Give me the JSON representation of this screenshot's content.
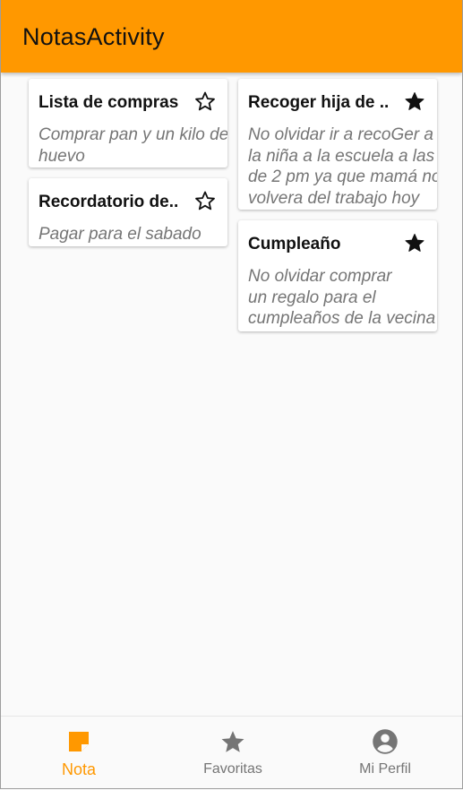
{
  "appbar": {
    "title": "NotasActivity"
  },
  "notes": [
    {
      "title": "Lista de compras",
      "body": "Comprar pan y un kilo de\nhuevo",
      "favorite": false
    },
    {
      "title": "Recordatorio de..",
      "body": "Pagar para el sabado",
      "favorite": false
    },
    {
      "title": "Recoger hija de ..",
      "body": "No olvidar ir a recoGer a\nla niña a la escuela a las\nde 2 pm ya que mamá no\nvolvera del trabajo hoy",
      "favorite": true
    },
    {
      "title": "Cumpleaño",
      "body": "No olvidar comprar\nun regalo para el\ncumpleaños de la vecina",
      "favorite": true
    }
  ],
  "bottom_nav": {
    "items": [
      {
        "label": "Nota",
        "icon": "note-icon",
        "active": true
      },
      {
        "label": "Favoritas",
        "icon": "star-icon",
        "active": false
      },
      {
        "label": "Mi Perfil",
        "icon": "account-circle-icon",
        "active": false
      }
    ]
  },
  "colors": {
    "primary": "#ff9800",
    "inactive": "#757575",
    "star": "#111111"
  }
}
